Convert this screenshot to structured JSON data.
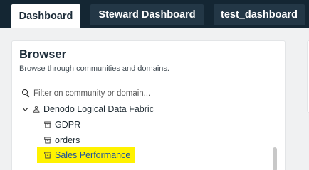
{
  "tabs": [
    {
      "label": "Dashboard",
      "active": true
    },
    {
      "label": "Steward Dashboard",
      "active": false
    },
    {
      "label": "test_dashboard",
      "active": false
    }
  ],
  "browser": {
    "title": "Browser",
    "subtitle": "Browse through communities and domains.",
    "filter_placeholder": "Filter on community or domain..."
  },
  "tree": {
    "root": {
      "label": "Denodo Logical Data Fabric",
      "expanded": true,
      "icon": "community-icon"
    },
    "items": [
      {
        "label": "GDPR",
        "icon": "domain-icon"
      },
      {
        "label": "orders",
        "icon": "domain-icon"
      },
      {
        "label": "Sales Performance",
        "icon": "domain-icon",
        "highlighted": true
      }
    ]
  },
  "colors": {
    "tabbar_bg": "#142633",
    "highlight": "#fff200",
    "link": "#1a4fa0"
  }
}
